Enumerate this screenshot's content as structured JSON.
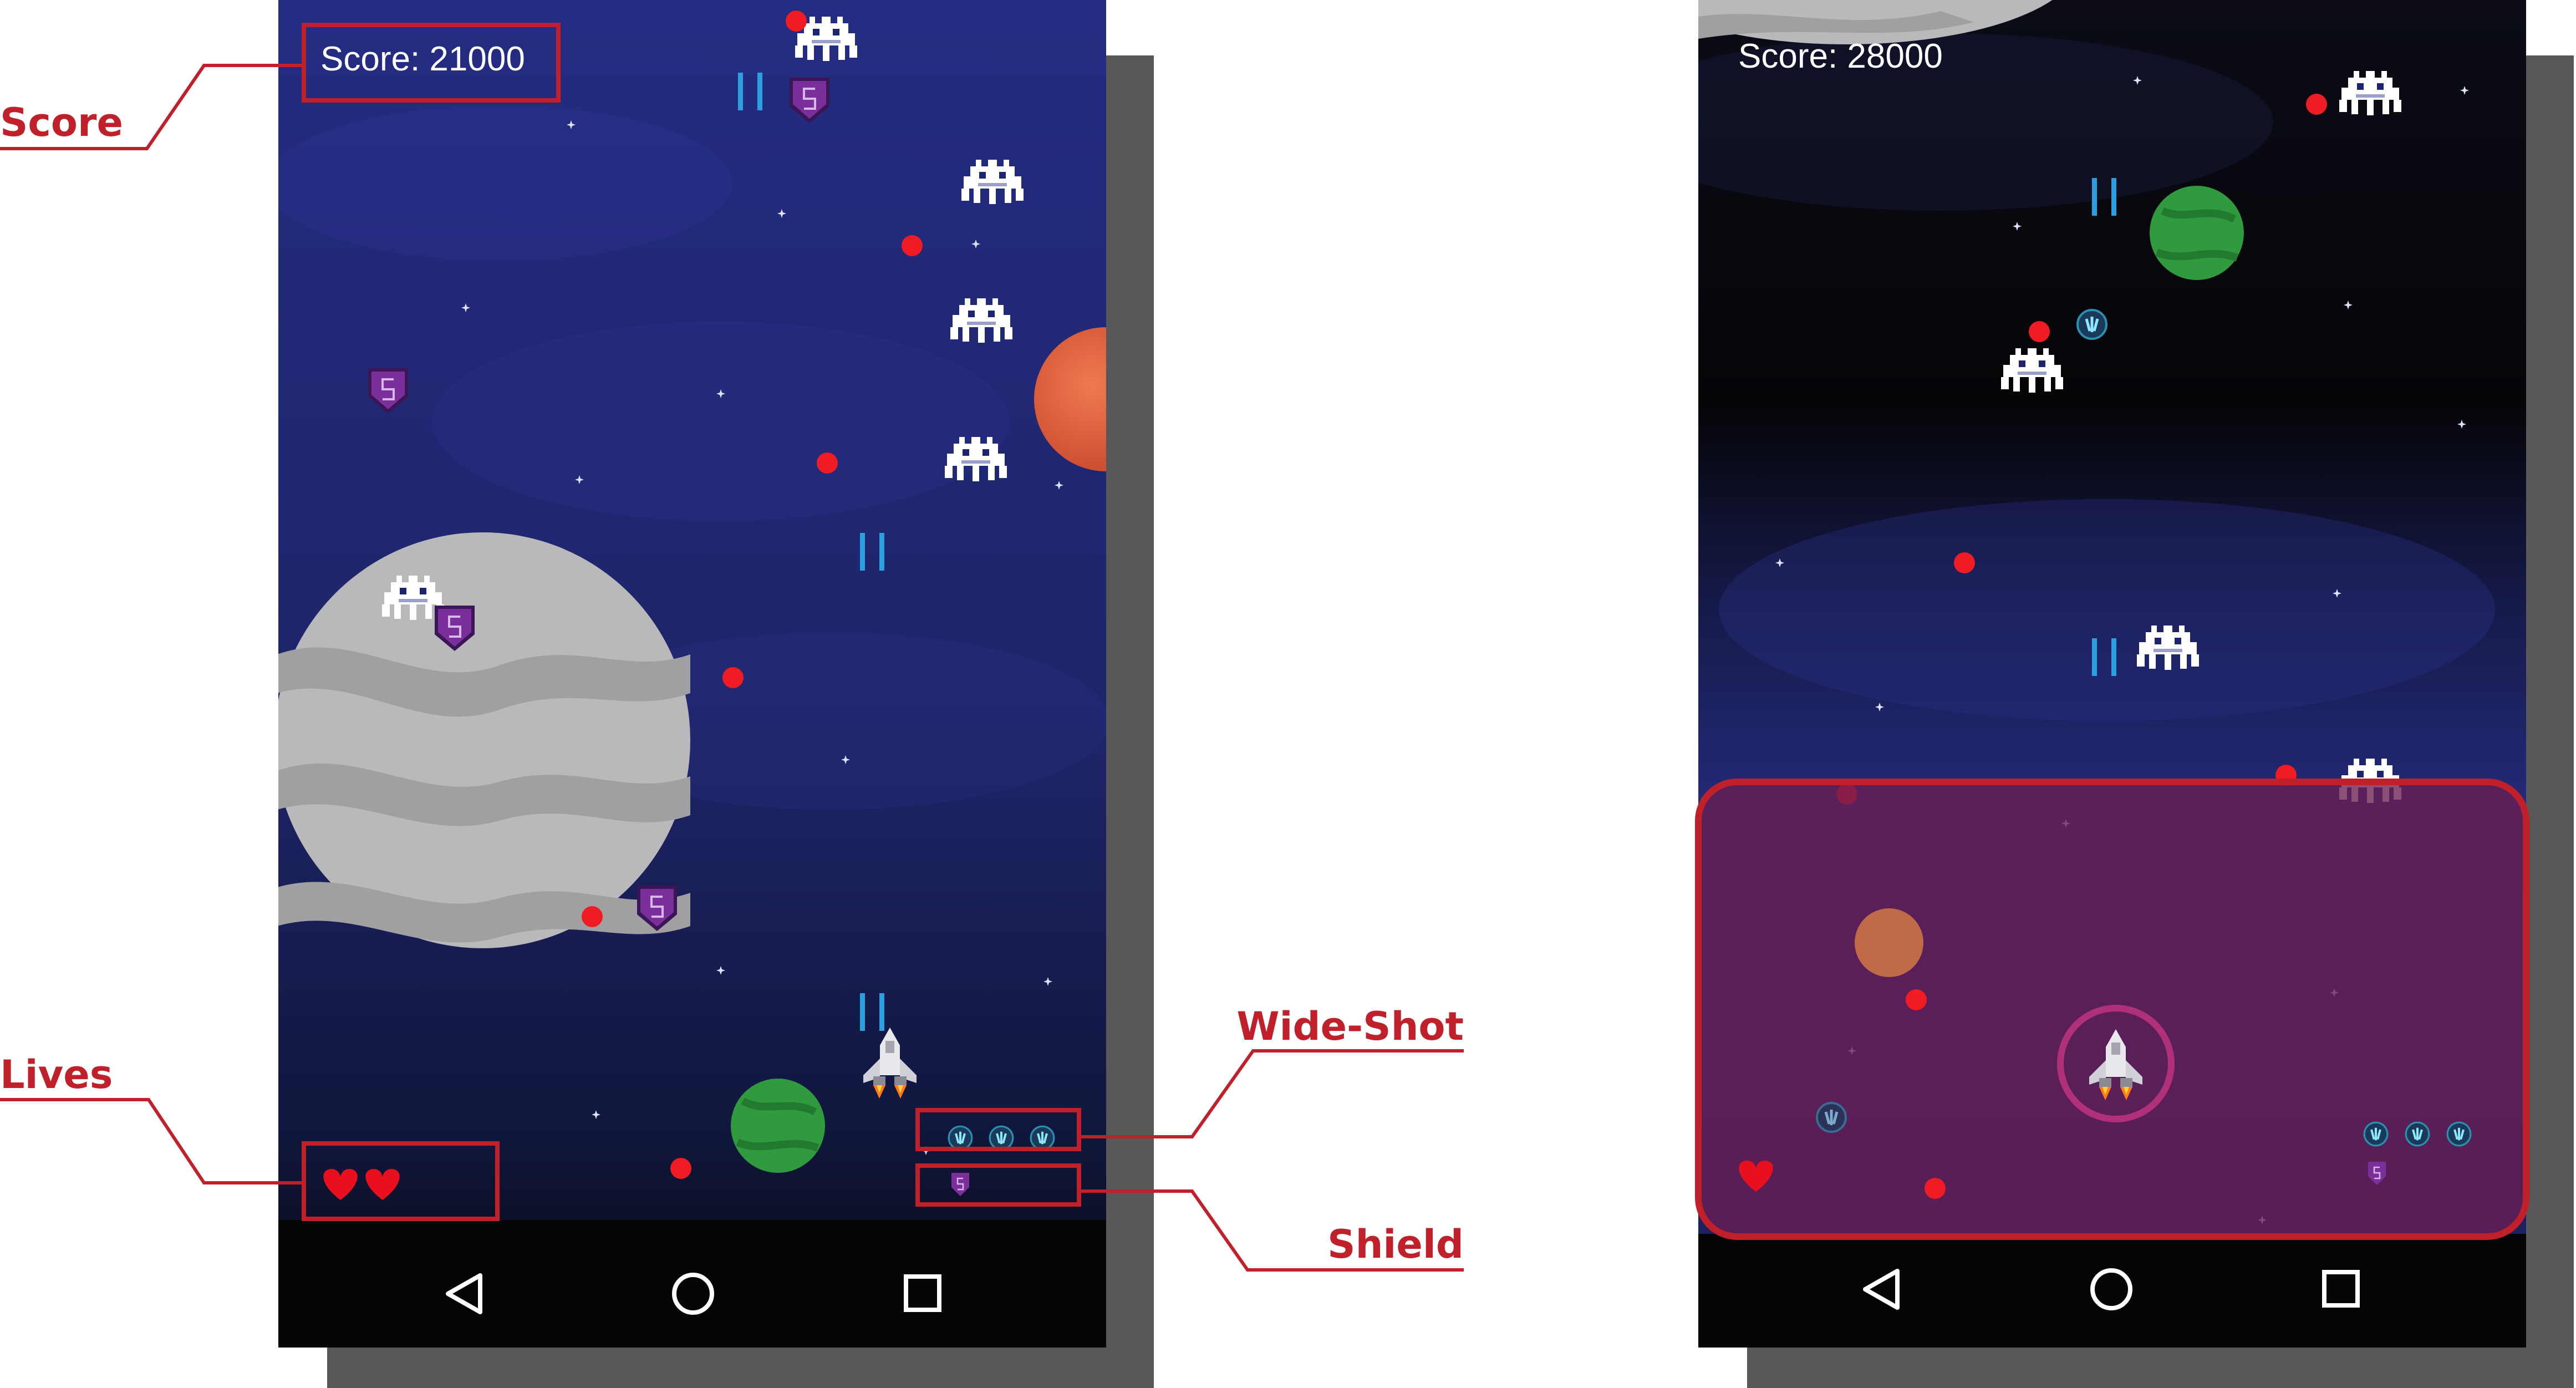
{
  "annotations": {
    "score": "Score",
    "lives": "Lives",
    "wide_shot": "Wide-Shot",
    "shield": "Shield"
  },
  "screen_left": {
    "score_text": "Score: 21000",
    "lives": 2,
    "wide_shot_count": 3,
    "shield_count": 1,
    "shield_letter": "S"
  },
  "screen_right": {
    "score_text": "Score: 28000",
    "lives": 1,
    "wide_shot_count": 3,
    "shield_count": 1,
    "shield_letter": "S"
  },
  "nav": {
    "back": "back-icon",
    "home": "home-icon",
    "recents": "recents-icon"
  },
  "colors": {
    "accent_red": "#c0202a",
    "space_blue": "#1c2470",
    "bullet_red": "#ef1c24",
    "laser_blue": "#2aa0e0",
    "shield_purple": "#7a2f9a",
    "heart_red": "#e8101e"
  }
}
